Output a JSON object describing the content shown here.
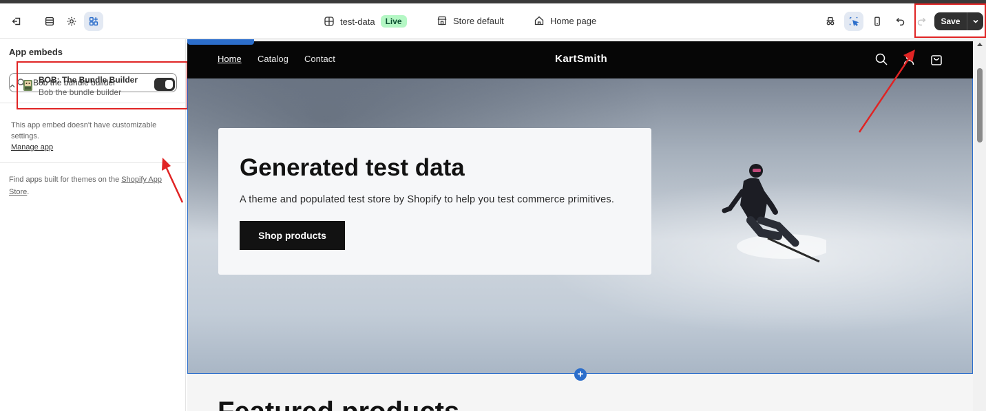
{
  "topbar": {
    "theme_name": "test-data",
    "live_badge": "Live",
    "store_default": "Store default",
    "home_page": "Home page",
    "save_label": "Save"
  },
  "sidebar": {
    "title": "App embeds",
    "search": {
      "value": "Bob the bundle builder",
      "placeholder": ""
    },
    "embed": {
      "name": "BOB: The Bundle Builder",
      "sub": "Bob the bundle builder",
      "enabled": true
    },
    "no_settings": "This app embed doesn't have customizable settings.",
    "manage_app": "Manage app",
    "find_apps_prefix": "Find apps built for themes on the ",
    "find_apps_link": "Shopify App Store",
    "find_apps_suffix": "."
  },
  "preview": {
    "nav": {
      "home": "Home",
      "catalog": "Catalog",
      "contact": "Contact"
    },
    "store_name": "KartSmith",
    "hero": {
      "title": "Generated test data",
      "text": "A theme and populated test store by Shopify to help you test commerce primitives.",
      "button": "Shop products"
    },
    "featured_title": "Featured products",
    "add_section": "+"
  },
  "colors": {
    "accent_blue": "#2c6ecb",
    "annotation_red": "#e02424",
    "live_green": "#b4f7c4",
    "primary_dark": "#303030"
  }
}
